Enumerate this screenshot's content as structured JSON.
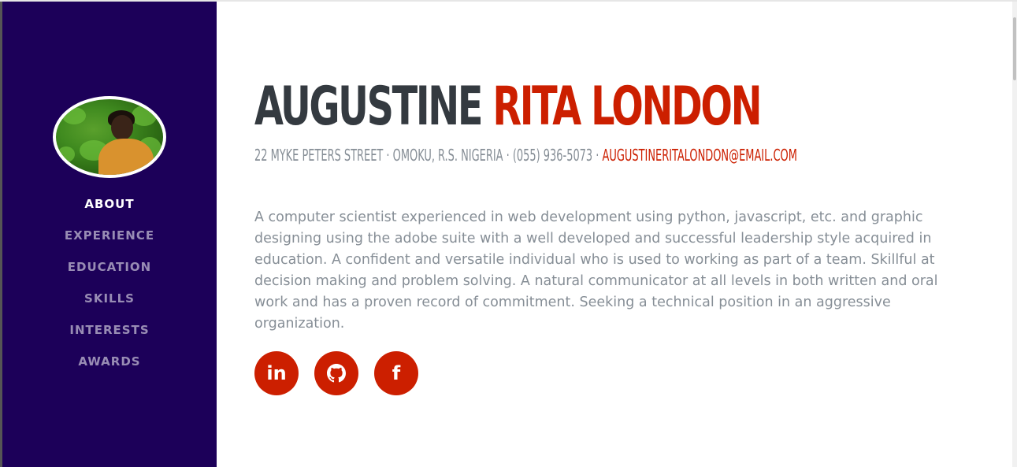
{
  "profile": {
    "first_name": "AUGUSTINE",
    "last_name": "RITA LONDON",
    "address": "22 MYKE PETERS STREET · OMOKU, R.S. NIGERIA · (055) 936-5073 · ",
    "email": "AUGUSTINERITALONDON@EMAIL.COM",
    "bio": "A computer scientist experienced in web development using python, javascript, etc. and graphic designing using the adobe suite with a well developed and successful leadership style acquired in education. A confident and versatile individual who is used to working as part of a team. Skillful at decision making and problem solving. A natural communicator at all levels in both written and oral work and has a proven record of commitment. Seeking a technical position in an aggressive organization."
  },
  "nav": {
    "items": [
      {
        "label": "ABOUT",
        "active": true
      },
      {
        "label": "EXPERIENCE",
        "active": false
      },
      {
        "label": "EDUCATION",
        "active": false
      },
      {
        "label": "SKILLS",
        "active": false
      },
      {
        "label": "INTERESTS",
        "active": false
      },
      {
        "label": "AWARDS",
        "active": false
      }
    ]
  },
  "social": {
    "linkedin_label": "in",
    "github_icon": "github-icon",
    "facebook_label": "f"
  },
  "colors": {
    "sidebar": "#1c0059",
    "accent": "#cc1f00",
    "name_dark": "#343a40",
    "muted_text": "#868e96"
  }
}
